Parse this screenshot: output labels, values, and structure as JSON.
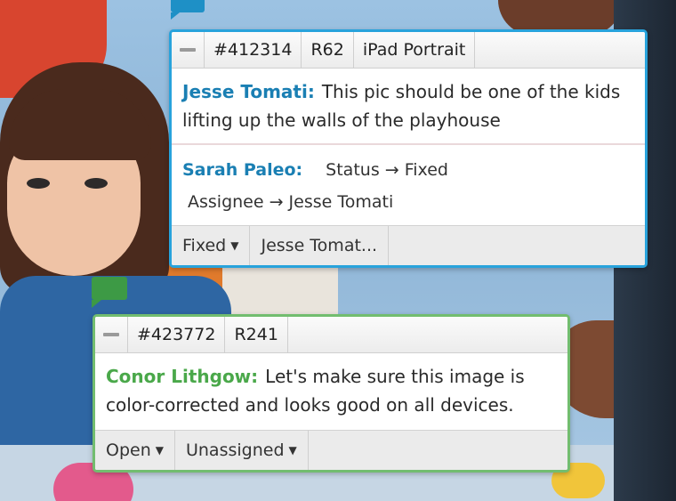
{
  "comments": [
    {
      "color": "#28a3dc",
      "id": "#412314",
      "revision": "R62",
      "device": "iPad Portrait",
      "author": "Jesse Tomati:",
      "text": "This pic should be one of the kids lifting up the walls of the playhouse",
      "activity": {
        "author": "Sarah Paleo:",
        "status_change": "Status → Fixed",
        "assignee_change": "Assignee → Jesse Tomati"
      },
      "status_dropdown": "Fixed",
      "assignee_dropdown": "Jesse Tomat..."
    },
    {
      "color": "#72bd6f",
      "id": "#423772",
      "revision": "R241",
      "author": "Conor Lithgow:",
      "text": "Let's make sure this image is color-corrected and looks good on all devices.",
      "status_dropdown": "Open",
      "assignee_dropdown": "Unassigned"
    }
  ],
  "icons": {
    "collapse": "minus-icon",
    "dropdown": "caret-down-icon",
    "pin": "comment-pin-icon"
  }
}
